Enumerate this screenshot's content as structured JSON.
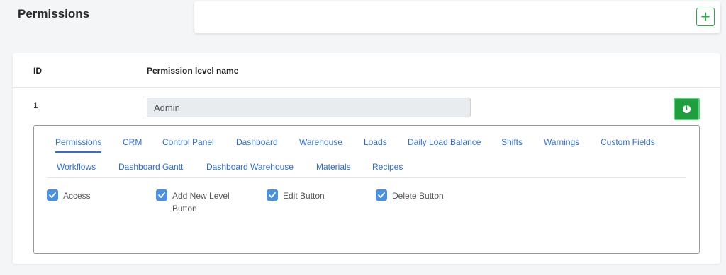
{
  "header": {
    "title": "Permissions",
    "add_label": "+"
  },
  "table": {
    "columns": [
      "ID",
      "Permission level name"
    ],
    "row": {
      "id": "1",
      "name": "Admin"
    }
  },
  "tabs": {
    "row1": [
      "Permissions",
      "CRM",
      "Control Panel",
      "Dashboard",
      "Warehouse",
      "Loads",
      "Daily Load Balance",
      "Shifts",
      "Warnings",
      "Custom Fields"
    ],
    "row2": [
      "Workflows",
      "Dashboard Gantt",
      "Dashboard Warehouse",
      "Materials",
      "Recipes"
    ],
    "active": "Permissions"
  },
  "checkboxes": [
    {
      "label": "Access",
      "checked": true
    },
    {
      "label": "Add New Level Button",
      "checked": true
    },
    {
      "label": "Edit Button",
      "checked": true
    },
    {
      "label": "Delete Button",
      "checked": true
    }
  ],
  "colors": {
    "accent": "#2f6fd6",
    "success": "#1e9e3e",
    "checkbox": "#4a90e2"
  },
  "icons": {
    "add": "plus-icon",
    "info": "info-icon",
    "check": "checkmark-icon"
  }
}
